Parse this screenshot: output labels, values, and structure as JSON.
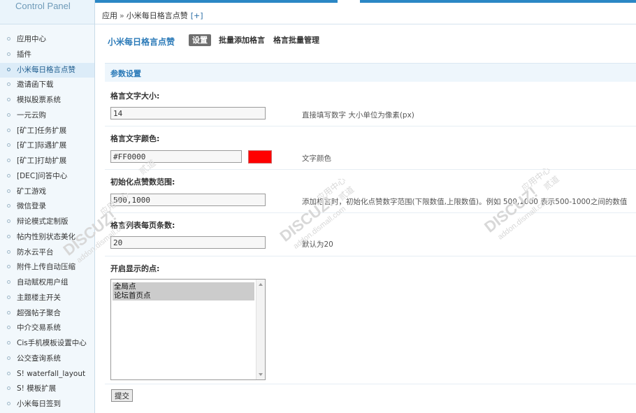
{
  "brand": "Control Panel",
  "breadcrumb": {
    "root": "应用",
    "sep": "»",
    "current": "小米每日格言点赞",
    "add": "[+]"
  },
  "sidebar": {
    "items": [
      {
        "label": "应用中心"
      },
      {
        "label": "插件"
      },
      {
        "label": "小米每日格言点赞",
        "active": true
      },
      {
        "label": "邀请函下载"
      },
      {
        "label": "模拟股票系统"
      },
      {
        "label": "一元云购"
      },
      {
        "label": "[矿工]任务扩展"
      },
      {
        "label": "[矿工]际遇扩展"
      },
      {
        "label": "[矿工]打劫扩展"
      },
      {
        "label": "[DEC]问答中心"
      },
      {
        "label": "矿工游戏"
      },
      {
        "label": "微信登录"
      },
      {
        "label": "辩论模式定制版"
      },
      {
        "label": "帖内性别状态美化"
      },
      {
        "label": "防水云平台"
      },
      {
        "label": "附件上传自动压缩"
      },
      {
        "label": "自动赋权用户组"
      },
      {
        "label": "主题楼主开关"
      },
      {
        "label": "超强帖子聚合"
      },
      {
        "label": "中介交易系统"
      },
      {
        "label": "Cis手机模板设置中心"
      },
      {
        "label": "公交查询系统"
      },
      {
        "label": "S! waterfall_layout"
      },
      {
        "label": "S! 模板扩展"
      },
      {
        "label": "小米每日签到"
      }
    ]
  },
  "plugin": {
    "title": "小米每日格言点赞",
    "tabs": [
      "设置",
      "批量添加格言",
      "格言批量管理"
    ]
  },
  "section_title": "参数设置",
  "fields": {
    "font_size": {
      "label": "格言文字大小:",
      "value": "14",
      "hint": "直接填写数字 大小单位为像素(px)"
    },
    "font_color": {
      "label": "格言文字颜色:",
      "value": "#FF0000",
      "hint": "文字颜色",
      "swatch": "#ff0000"
    },
    "like_range": {
      "label": "初始化点赞数范围:",
      "value": "500,1000",
      "hint": "添加格言时，初始化点赞数字范围(下限数值,上限数值)。例如 500,1000 表示500-1000之间的数值"
    },
    "per_page": {
      "label": "格言列表每页条数:",
      "value": "20",
      "hint": "默认为20"
    },
    "show_on": {
      "label": "开启显示的点:",
      "options": [
        "全局点",
        "论坛首页点"
      ]
    }
  },
  "submit_label": "提交",
  "watermark": {
    "brand": "DISCUZ!",
    "site": "addon.dismall.com",
    "tag1": "应用中心",
    "tag2": "贰道"
  },
  "colors": {
    "accent": "#2b87c5",
    "title": "#2b7ab8",
    "sidebar_bg": "#f2f8fc"
  }
}
